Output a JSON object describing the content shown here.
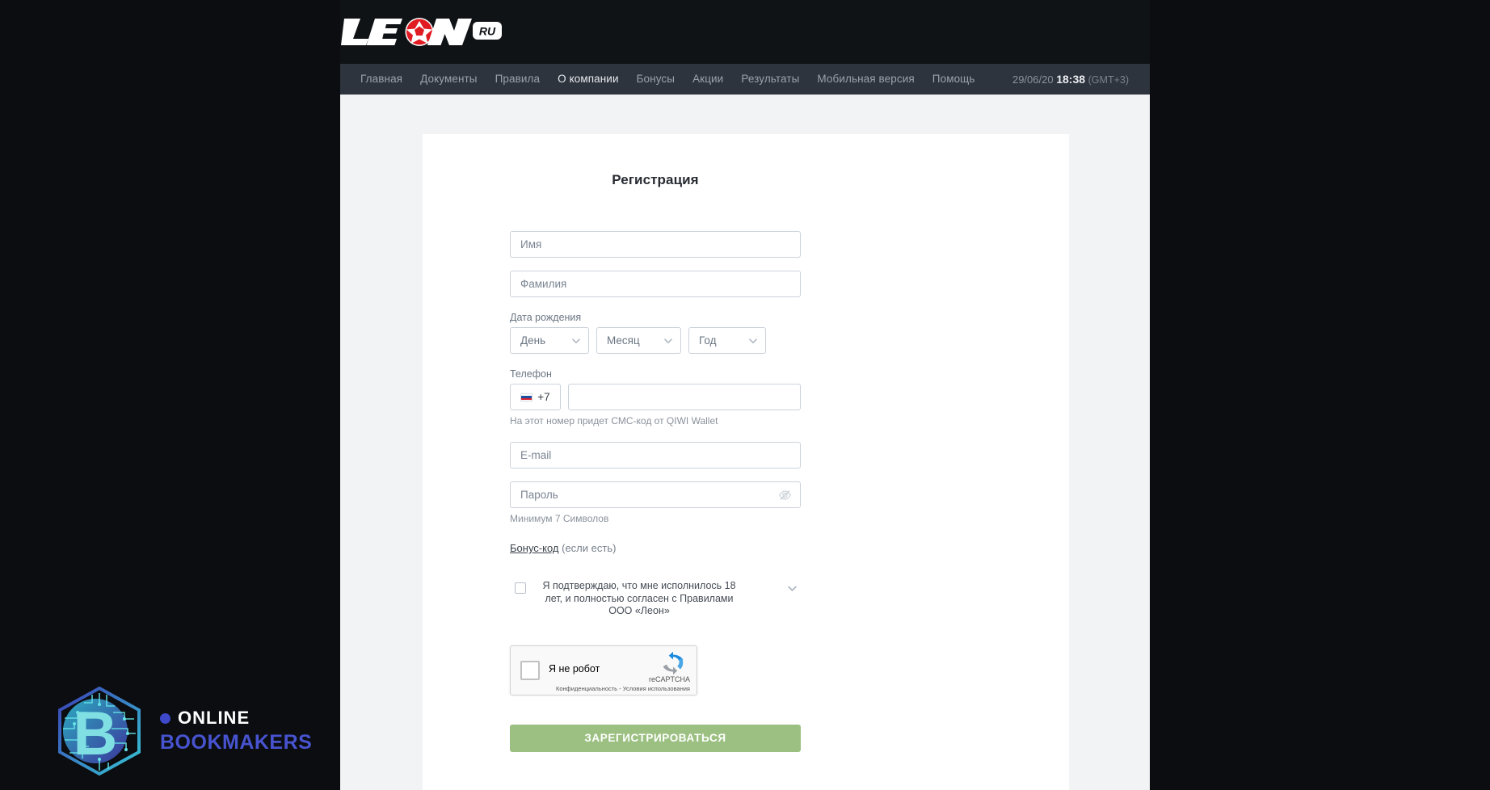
{
  "brand": {
    "logo_text": "LEON",
    "logo_suffix": "RU"
  },
  "nav": {
    "items": [
      {
        "label": "Главная",
        "active": false
      },
      {
        "label": "Документы",
        "active": false
      },
      {
        "label": "Правила",
        "active": false
      },
      {
        "label": "О компании",
        "active": true
      },
      {
        "label": "Бонусы",
        "active": false
      },
      {
        "label": "Акции",
        "active": false
      },
      {
        "label": "Результаты",
        "active": false
      },
      {
        "label": "Мобильная версия",
        "active": false
      },
      {
        "label": "Помощь",
        "active": false
      }
    ],
    "date": "29/06/20",
    "time": "18:38",
    "gmt": "(GMT+3)"
  },
  "form": {
    "title": "Регистрация",
    "first_name_placeholder": "Имя",
    "first_name_value": "",
    "last_name_placeholder": "Фамилия",
    "last_name_value": "",
    "dob_label": "Дата рождения",
    "dob_day": "День",
    "dob_month": "Месяц",
    "dob_year": "Год",
    "phone_label": "Телефон",
    "country_code": "+7",
    "country_flag": "ru-flag-icon",
    "phone_value": "",
    "phone_hint": "На этот номер придет СМС-код от QIWI Wallet",
    "email_placeholder": "E-mail",
    "email_value": "",
    "password_placeholder": "Пароль",
    "password_value": "",
    "password_hint": "Минимум 7 Символов",
    "bonus_link": "Бонус-код",
    "bonus_note": "(если есть)",
    "agreement_text": "Я подтверждаю, что мне исполнилось 18 лет, и полностью согласен с Правилами ООО «Леон»",
    "agreement_checked": false,
    "submit_label": "ЗАРЕГИСТРИРОВАТЬСЯ"
  },
  "recaptcha": {
    "label": "Я не робот",
    "brand": "reCAPTCHA",
    "privacy": "Конфиденциальность",
    "separator": " - ",
    "terms": "Условия использования"
  },
  "watermark": {
    "line1": "ONLINE",
    "line2": "BOOKMAKERS",
    "mark_letter": "B"
  },
  "colors": {
    "page_dark": "#0b0d10",
    "header_dark": "#101316",
    "navbar": "#2e343d",
    "page_bg": "#f1f3f5",
    "card": "#ffffff",
    "accent_red": "#e11b22",
    "submit_green": "#9cc082",
    "border": "#ccd2da",
    "text_muted": "#6b7683",
    "watermark_blue": "#4753cf"
  }
}
